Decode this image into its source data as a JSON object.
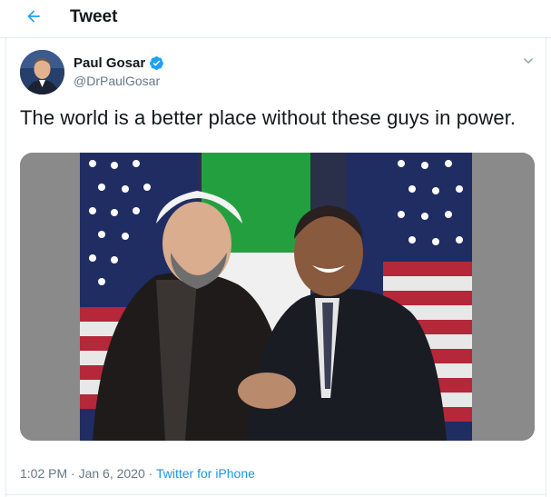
{
  "header": {
    "title": "Tweet",
    "back_icon": "arrow-left-icon"
  },
  "tweet": {
    "author": {
      "display_name": "Paul Gosar",
      "handle": "@DrPaulGosar",
      "verified": true,
      "verified_icon": "verified-badge-icon"
    },
    "text": "The world is a better place without these guys in power.",
    "timestamp": "1:02 PM · Jan 6, 2020",
    "separator": " · ",
    "source": "Twitter for iPhone",
    "more_icon": "chevron-down-icon"
  },
  "colors": {
    "accent": "#1da1f2",
    "link": "#1b95e0",
    "secondary_text": "#657786",
    "primary_text": "#14171a",
    "divider": "#e6ecf0"
  }
}
